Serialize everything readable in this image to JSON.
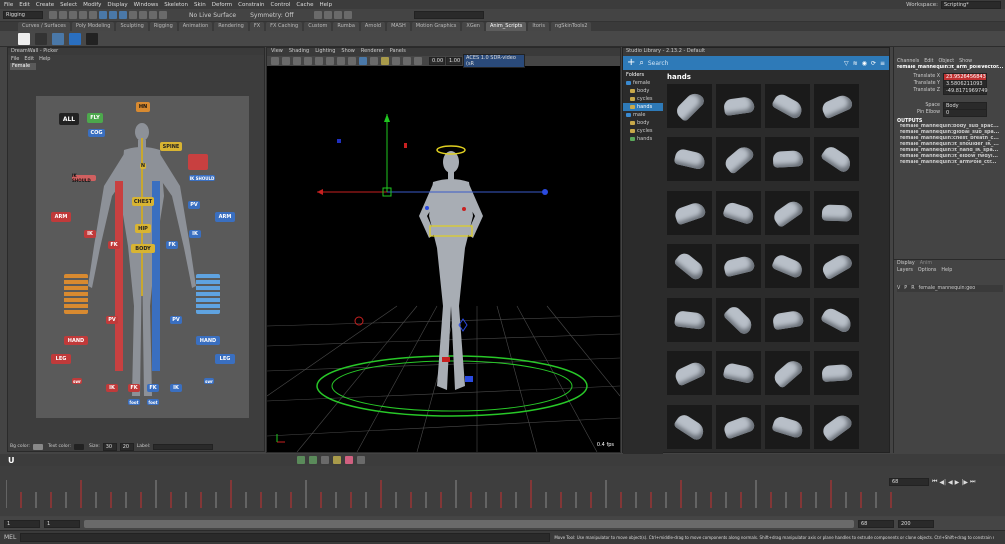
{
  "menubar": {
    "items": [
      "File",
      "Edit",
      "Create",
      "Select",
      "Modify",
      "Display",
      "Windows",
      "Skeleton",
      "Skin",
      "Deform",
      "Constrain",
      "Control",
      "Cache",
      "Help"
    ],
    "workspace_label": "Workspace:",
    "workspace_value": "Scripting*"
  },
  "status": {
    "mode": "Rigging",
    "live_surface": "No Live Surface",
    "symmetry": "Symmetry: Off"
  },
  "shelf_tabs": [
    "Curves / Surfaces",
    "Poly Modeling",
    "Sculpting",
    "Rigging",
    "Animation",
    "Rendering",
    "FX",
    "FX Caching",
    "Custom",
    "Rumba",
    "Arnold",
    "MASH",
    "Motion Graphics",
    "XGen",
    "Anim_Scripts",
    "Itoris",
    "ngSkinTools2"
  ],
  "shelf_active": "Anim_Scripts",
  "picker": {
    "title": "DreamWall - Picker",
    "menu": [
      "File",
      "Edit",
      "Help"
    ],
    "tab": "Female",
    "labels": {
      "all": "ALL",
      "fly": "FLY",
      "cog": "COG",
      "hn": "HN",
      "spine": "SPINE",
      "chest": "CHEST",
      "hip": "HIP",
      "body": "BODY",
      "arm_l": "ARM",
      "arm_r": "ARM",
      "ik_l": "IK",
      "fk_l": "FK",
      "fk_r": "FK",
      "ik_r": "IK",
      "pv_l": "PV",
      "pv_r": "PV",
      "pv_ll": "PV",
      "pv_rr": "PV",
      "hand_l": "HAND",
      "hand_r": "HAND",
      "leg_l": "LEG",
      "leg_r": "LEG",
      "ik_leg_l": "IK",
      "fk_leg_l": "FK",
      "fk_leg_r": "FK",
      "ik_leg_r": "IK",
      "should_l": "IK SHOULD",
      "should_r": "IK SHOULD",
      "n": "N",
      "sw_l": "swr",
      "sw_r": "swr",
      "foot_l": "foot",
      "foot_r": "foot"
    },
    "bottom": {
      "bg_color": "Bg color:",
      "text_color": "Text color:",
      "size_label": "Size:",
      "size_w": "30",
      "size_h": "20",
      "label": "Label:"
    }
  },
  "viewport": {
    "menu": [
      "View",
      "Shading",
      "Lighting",
      "Show",
      "Renderer",
      "Panels"
    ],
    "fps": "0.4 fps",
    "cam_value": "0.00",
    "near_value": "1.00",
    "colorspace": "ACES 1.0 SDR-video (sR"
  },
  "library": {
    "title": "Studio Library - 2.13.2 - Default",
    "search_placeholder": "Search",
    "folders_label": "Folders",
    "folders": [
      {
        "name": "female",
        "level": 0,
        "color": "blue"
      },
      {
        "name": "body",
        "level": 1,
        "color": "yellow"
      },
      {
        "name": "cycles",
        "level": 1,
        "color": "yellow"
      },
      {
        "name": "hands",
        "level": 1,
        "color": "yellow",
        "selected": true
      },
      {
        "name": "male",
        "level": 0,
        "color": "blue"
      },
      {
        "name": "body",
        "level": 1,
        "color": "yellow"
      },
      {
        "name": "cycles",
        "level": 1,
        "color": "yellow"
      },
      {
        "name": "hands",
        "level": 1,
        "color": "green"
      }
    ],
    "current": "hands",
    "thumb_count": 28
  },
  "channelbox": {
    "tabs": [
      "Channels",
      "Edit",
      "Object",
      "Show"
    ],
    "object": "female_mannequin:lt_arm_poleVector...",
    "channels": [
      {
        "name": "Translate X",
        "value": "23.9526456843"
      },
      {
        "name": "Translate Y",
        "value": "3.5806211093"
      },
      {
        "name": "Translate Z",
        "value": "-49.8171969749"
      },
      {
        "name": "Space",
        "value": "Body"
      },
      {
        "name": "Pin Elbow",
        "value": "0"
      }
    ],
    "outputs_label": "OUTPUTS",
    "outputs": [
      "female_mannequin:body_sub_spac...",
      "female_mannequin:global_sub_spa...",
      "female_mannequin:chest_breath_c...",
      "female_mannequin:lt_shoulder_IK_...",
      "female_mannequin:lt_hand_IK_spa...",
      "female_mannequin:lt_elbow_fwdyl...",
      "female_mannequin:lt_armPole_ctr..."
    ],
    "layer_tabs": [
      "Display",
      "Anim"
    ],
    "layer_menu": [
      "Layers",
      "Options",
      "Help"
    ],
    "layer_vp": "V",
    "layer_p": "P",
    "layer_r": "R",
    "layer_name": "female_mannequin:geo"
  },
  "timeline": {
    "current_frame": "68",
    "start": "1",
    "start2": "1",
    "end": "68",
    "end2": "200",
    "cmd_label": "MEL",
    "help": "Move Tool: Use manipulator to move object(s). Ctrl+middle-drag to move components along normals. Shift+drag manipulator axis or plane handles to extrude components or clone objects. Ctrl+Shift+drag to constrain movement to a connected edge. Us"
  },
  "colors": {
    "accent": "#2e7ab8",
    "bg": "#444444",
    "viewport": "#000000",
    "grid": "#4a4a4a",
    "ring": "#28c828"
  }
}
